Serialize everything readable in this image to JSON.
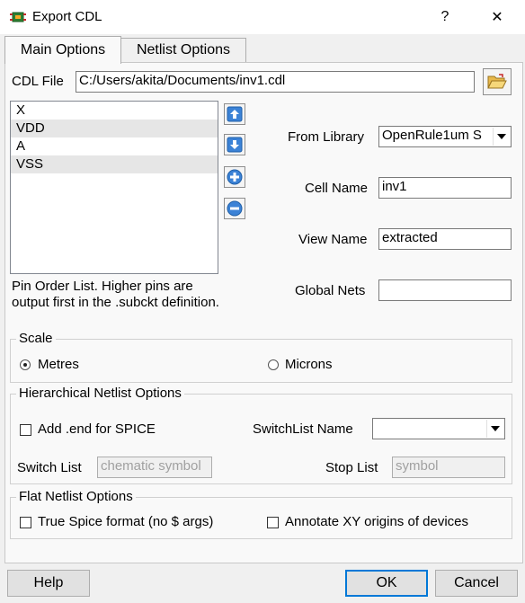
{
  "window": {
    "title": "Export CDL",
    "help_glyph": "?",
    "close_glyph": "✕"
  },
  "tabs": [
    {
      "label": "Main Options"
    },
    {
      "label": "Netlist Options"
    }
  ],
  "cdl_file": {
    "label": "CDL File",
    "value": "C:/Users/akita/Documents/inv1.cdl"
  },
  "pin_list": {
    "items": [
      "X",
      "VDD",
      "A",
      "VSS"
    ],
    "description": "Pin Order List. Higher pins are output first in the .subckt definition."
  },
  "from_library": {
    "label": "From Library",
    "value": "OpenRule1um S"
  },
  "cell_name": {
    "label": "Cell Name",
    "value": "inv1"
  },
  "view_name": {
    "label": "View Name",
    "value": "extracted"
  },
  "global_nets": {
    "label": "Global Nets",
    "value": ""
  },
  "scale": {
    "title": "Scale",
    "option_metres": "Metres",
    "option_microns": "Microns",
    "selected": "Metres"
  },
  "hierarchical": {
    "title": "Hierarchical Netlist Options",
    "add_end_label": "Add .end for SPICE",
    "add_end_checked": false,
    "switchlist_label": "SwitchList Name",
    "switchlist_value": "",
    "switch_list_label": "Switch List",
    "switch_list_value": "chematic symbol",
    "stop_list_label": "Stop List",
    "stop_list_value": "symbol"
  },
  "flat": {
    "title": "Flat Netlist Options",
    "true_spice_label": "True Spice format (no $ args)",
    "true_spice_checked": false,
    "annotate_label": "Annotate XY origins of devices",
    "annotate_checked": false
  },
  "buttons": {
    "help": "Help",
    "ok": "OK",
    "cancel": "Cancel"
  }
}
